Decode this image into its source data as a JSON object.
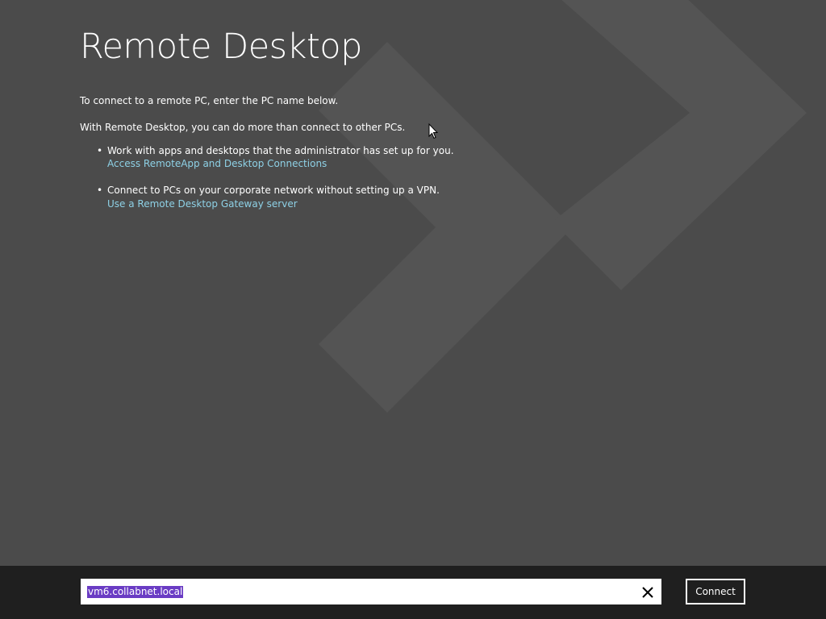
{
  "app": {
    "title": "Remote Desktop"
  },
  "intro": {
    "line1": "To connect to a remote PC, enter the PC name below.",
    "line2": "With Remote Desktop, you can do more than connect to other PCs."
  },
  "features": [
    {
      "bullet": "•",
      "text": "Work with apps and desktops that the administrator has set up for you.",
      "link": "Access RemoteApp and Desktop Connections"
    },
    {
      "bullet": "•",
      "text": "Connect to PCs on your corporate network without setting up a VPN.",
      "link": "Use a Remote Desktop Gateway server"
    }
  ],
  "bottom_bar": {
    "pc_name_value": "vm6.collabnet.local",
    "clear_icon": "close-icon",
    "connect_label": "Connect"
  },
  "colors": {
    "background": "#4b4b4b",
    "bottom_bar": "#1f1f1f",
    "link": "#8ed1e6",
    "selection": "#6a3cc4"
  }
}
